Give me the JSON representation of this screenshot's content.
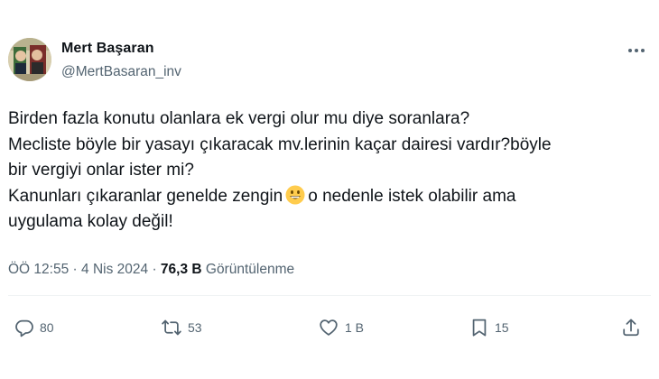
{
  "author": {
    "display_name": "Mert Başaran",
    "handle": "@MertBasaran_inv",
    "avatar_icon": "profile-photo"
  },
  "tweet": {
    "lines": [
      "Birden fazla konutu olanlara ek vergi olur mu diye soranlara?",
      "Mecliste böyle bir yasayı çıkaracak mv.lerinin kaçar dairesi vardır?böyle",
      "bir vergiyi onlar ister mi?",
      "Kanunları çıkaranlar genelde zengin",
      "o nedenle istek olabilir ama",
      "uygulama kolay değil!"
    ],
    "emoji": "grinning-face"
  },
  "meta": {
    "time": "ÖÖ 12:55",
    "separator": "·",
    "date": "4 Nis 2024",
    "views_count": "76,3 B",
    "views_label": "Görüntülenme"
  },
  "actions": {
    "replies": "80",
    "retweets": "53",
    "likes": "1 B",
    "bookmarks": "15"
  },
  "colors": {
    "text": "#0f1419",
    "secondary": "#536471",
    "divider": "#eff3f4",
    "background": "#ffffff"
  }
}
